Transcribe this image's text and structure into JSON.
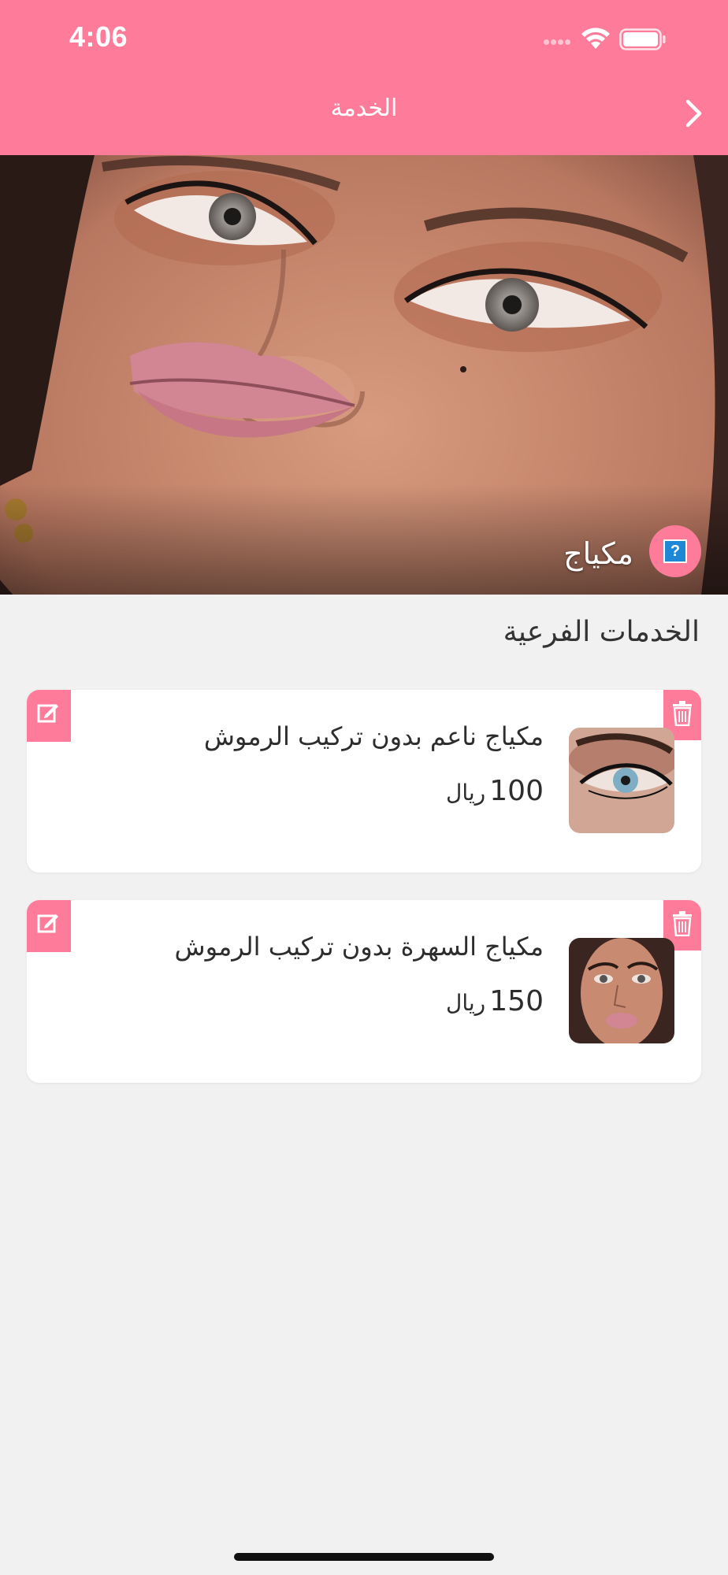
{
  "status_bar": {
    "time": "4:06"
  },
  "header": {
    "title": "الخدمة",
    "back_icon": "chevron-right-icon"
  },
  "hero": {
    "label": "مكياج",
    "badge_icon": "question-icon",
    "badge_text": "?"
  },
  "section": {
    "title": "الخدمات الفرعية"
  },
  "services": [
    {
      "name": "مكياج ناعم بدون تركيب الرموش",
      "price": "100",
      "currency": "ريال"
    },
    {
      "name": "مكياج السهرة بدون تركيب الرموش",
      "price": "150",
      "currency": "ريال"
    }
  ],
  "colors": {
    "brand": "#ff7b9a",
    "background": "#f1f1f1",
    "card": "#ffffff",
    "text": "#2d2d2d"
  }
}
